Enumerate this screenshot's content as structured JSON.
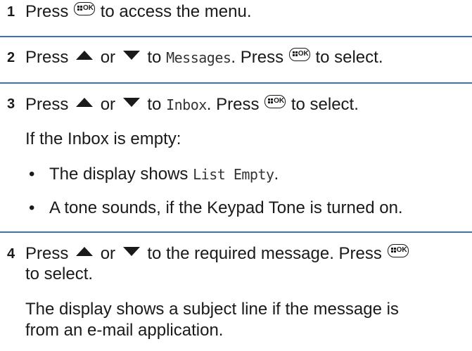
{
  "steps": [
    {
      "number": "1",
      "text_a": "Press",
      "text_b": "to access the menu."
    },
    {
      "number": "2",
      "text_a": "Press",
      "text_or": "or",
      "text_to": "to",
      "menu_item": "Messages",
      "text_press": ". Press",
      "text_end": "to select."
    },
    {
      "number": "3",
      "text_a": "Press",
      "text_or": "or",
      "text_to": "to",
      "menu_item": "Inbox",
      "text_press": ". Press",
      "text_end": "to select.",
      "condition": "If the Inbox is empty:",
      "bullets": [
        {
          "a": "The display shows",
          "mono": "List Empty",
          "b": "."
        },
        {
          "a": "A tone sounds, if the Keypad Tone is turned on."
        }
      ]
    },
    {
      "number": "4",
      "text_a": "Press",
      "text_or": "or",
      "text_b": "to the required message. Press",
      "line2": "to select.",
      "para_line1": "The display shows a subject line if the message is",
      "para_line2": "from an e-mail application."
    }
  ],
  "key_label": "OK",
  "bullet_char": "•"
}
